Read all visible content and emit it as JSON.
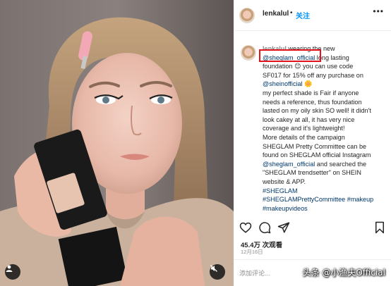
{
  "post": {
    "username": "lenkalul",
    "follow_separator": "•",
    "follow_label": "关注",
    "more_label": "•••"
  },
  "caption": {
    "lines": [
      [
        {
          "t": "lenkalul",
          "c": "cap-user"
        },
        {
          "t": " wearing the new",
          "c": ""
        }
      ],
      [
        {
          "t": "@sheglam_official",
          "c": "link"
        },
        {
          "t": " long lasting",
          "c": ""
        }
      ],
      [
        {
          "t": "foundation 😊 you can use code",
          "c": ""
        }
      ],
      [
        {
          "t": "SF017 for 15% off any purchase on",
          "c": ""
        }
      ],
      [
        {
          "t": "@sheinofficial",
          "c": "link"
        },
        {
          "t": " 🌼",
          "c": ""
        }
      ],
      [
        {
          "t": "my perfect shade is Fair if anyone",
          "c": ""
        }
      ],
      [
        {
          "t": "needs a reference, thus foundation",
          "c": ""
        }
      ],
      [
        {
          "t": "lasted on my oily skin SO well! it didn't",
          "c": ""
        }
      ],
      [
        {
          "t": "look cakey at all, it has very nice",
          "c": ""
        }
      ],
      [
        {
          "t": "coverage and it's lightweight!",
          "c": ""
        }
      ],
      [
        {
          "t": "More details of the campaign",
          "c": ""
        }
      ],
      [
        {
          "t": "SHEGLAM Pretty Committee can be",
          "c": ""
        }
      ],
      [
        {
          "t": "found on SHEGLAM official Instagram",
          "c": ""
        }
      ],
      [
        {
          "t": "@sheglam_official",
          "c": "link"
        },
        {
          "t": " and searched the",
          "c": ""
        }
      ],
      [
        {
          "t": "\"SHEGLAM trendsetter\" on SHEIN",
          "c": ""
        }
      ],
      [
        {
          "t": "website & APP.",
          "c": ""
        }
      ],
      [
        {
          "t": "#SHEGLAM",
          "c": "link"
        }
      ],
      [
        {
          "t": "#SHEGLAMPrettyCommittee",
          "c": "link"
        },
        {
          "t": " ",
          "c": ""
        },
        {
          "t": "#makeup",
          "c": "link"
        }
      ],
      [
        {
          "t": "#makeupvideos",
          "c": "link"
        }
      ]
    ]
  },
  "stats": {
    "views": "45.4万 次观看",
    "date": "12月16日"
  },
  "comment_box": {
    "placeholder": "添加评论..."
  },
  "watermark": "头条 @小渔夫Official",
  "icons": [
    "heart-icon",
    "comment-icon",
    "share-icon",
    "bookmark-icon",
    "user-tag-icon",
    "mute-icon",
    "more-icon"
  ],
  "colors": {
    "link": "#00376b",
    "follow": "#0095f6",
    "highlight_box": "#e1141b"
  }
}
